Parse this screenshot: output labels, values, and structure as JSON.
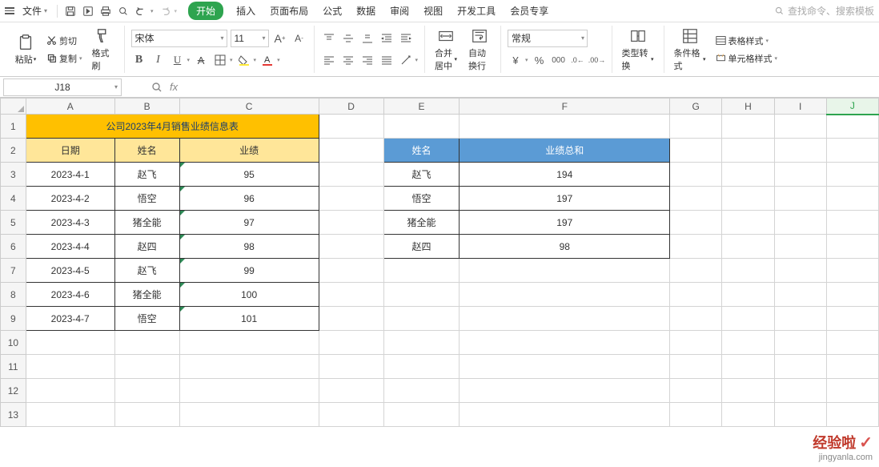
{
  "menu": {
    "file": "文件",
    "tabs": [
      "开始",
      "插入",
      "页面布局",
      "公式",
      "数据",
      "审阅",
      "视图",
      "开发工具",
      "会员专享"
    ],
    "search_placeholder": "查找命令、搜索模板"
  },
  "ribbon": {
    "paste": "粘贴",
    "cut": "剪切",
    "copy": "复制",
    "format_painter": "格式刷",
    "font_name": "宋体",
    "font_size": "11",
    "merge": "合并居中",
    "wrap": "自动换行",
    "number_format": "常规",
    "type_convert": "类型转换",
    "cond_format": "条件格式",
    "table_style": "表格样式",
    "cell_style": "单元格样式"
  },
  "namebox": "J18",
  "fx": "fx",
  "columns": [
    "A",
    "B",
    "C",
    "D",
    "E",
    "F",
    "G",
    "H",
    "I",
    "J"
  ],
  "rows": [
    "1",
    "2",
    "3",
    "4",
    "5",
    "6",
    "7",
    "8",
    "9",
    "10",
    "11",
    "12",
    "13"
  ],
  "table1": {
    "title": "公司2023年4月销售业绩信息表",
    "headers": [
      "日期",
      "姓名",
      "业绩"
    ],
    "rows": [
      [
        "2023-4-1",
        "赵飞",
        "95"
      ],
      [
        "2023-4-2",
        "悟空",
        "96"
      ],
      [
        "2023-4-3",
        "猪全能",
        "97"
      ],
      [
        "2023-4-4",
        "赵四",
        "98"
      ],
      [
        "2023-4-5",
        "赵飞",
        "99"
      ],
      [
        "2023-4-6",
        "猪全能",
        "100"
      ],
      [
        "2023-4-7",
        "悟空",
        "101"
      ]
    ]
  },
  "table2": {
    "headers": [
      "姓名",
      "业绩总和"
    ],
    "rows": [
      [
        "赵飞",
        "194"
      ],
      [
        "悟空",
        "197"
      ],
      [
        "猪全能",
        "197"
      ],
      [
        "赵四",
        "98"
      ]
    ]
  },
  "watermark": {
    "main": "经验啦",
    "sub": "jingyanla.com"
  }
}
